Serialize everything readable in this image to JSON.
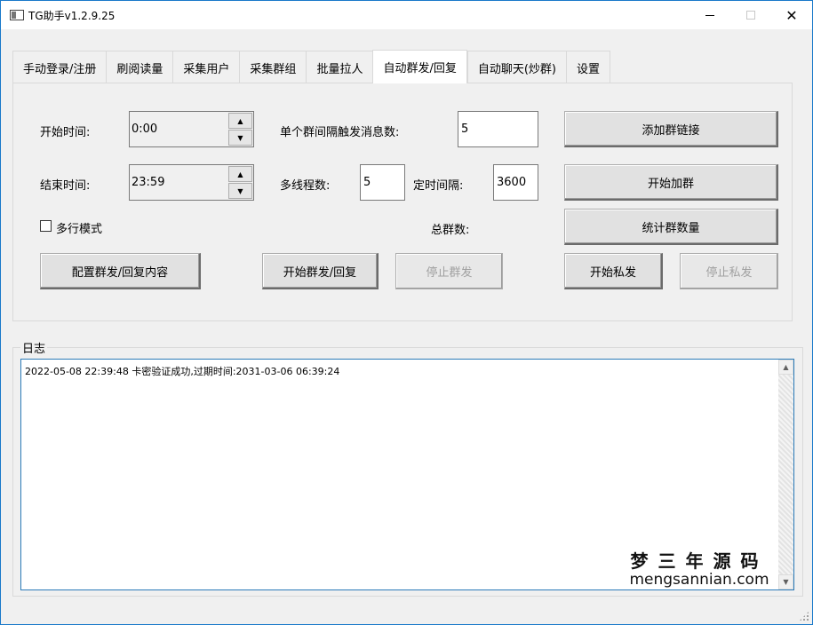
{
  "window": {
    "title": "TG助手v1.2.9.25",
    "controls": {
      "minimize": "—",
      "maximize": "☐",
      "close": "✕"
    }
  },
  "tabs": [
    {
      "label": "手动登录/注册",
      "active": false
    },
    {
      "label": "刷阅读量",
      "active": false
    },
    {
      "label": "采集用户",
      "active": false
    },
    {
      "label": "采集群组",
      "active": false
    },
    {
      "label": "批量拉人",
      "active": false
    },
    {
      "label": "自动群发/回复",
      "active": true
    },
    {
      "label": "自动聊天(炒群)",
      "active": false
    },
    {
      "label": "设置",
      "active": false
    }
  ],
  "form": {
    "start_time_label": "开始时间:",
    "start_time_value": "0:00",
    "end_time_label": "结束时间:",
    "end_time_value": "23:59",
    "per_group_interval_label": "单个群间隔触发消息数:",
    "per_group_interval_value": "5",
    "threads_label": "多线程数:",
    "threads_value": "5",
    "timer_interval_label": "定时间隔:",
    "timer_interval_value": "3600",
    "multiline_label": "多行模式",
    "multiline_checked": false,
    "total_groups_label": "总群数:"
  },
  "buttons": {
    "add_group_link": "添加群链接",
    "start_join": "开始加群",
    "count_groups": "统计群数量",
    "configure_content": "配置群发/回复内容",
    "start_broadcast": "开始群发/回复",
    "stop_broadcast": "停止群发",
    "start_private": "开始私发",
    "stop_private": "停止私发"
  },
  "log": {
    "label": "日志",
    "lines": [
      "2022-05-08 22:39:48 卡密验证成功,过期时间:2031-03-06 06:39:24"
    ]
  },
  "watermark": {
    "cn": "梦三年源码",
    "en": "mengsannian.com"
  }
}
